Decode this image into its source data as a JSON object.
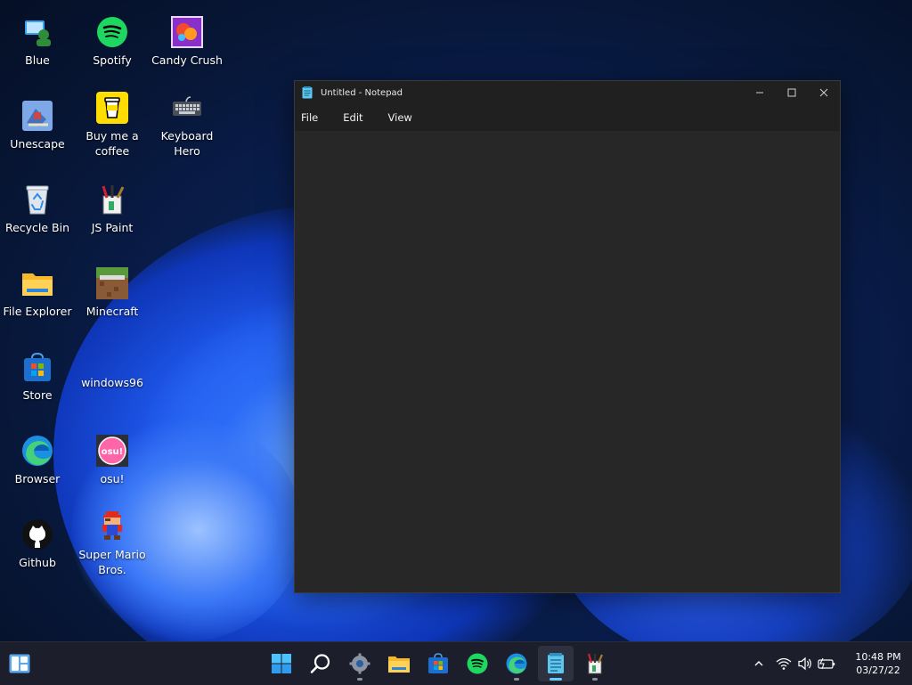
{
  "desktop": {
    "icons": [
      {
        "id": "blue",
        "label": "Blue"
      },
      {
        "id": "spotify",
        "label": "Spotify"
      },
      {
        "id": "candy-crush",
        "label": "Candy Crush"
      },
      {
        "id": "unescape",
        "label": "Unescape"
      },
      {
        "id": "buy-me-a-coffee",
        "label": "Buy me a coffee"
      },
      {
        "id": "keyboard-hero",
        "label": "Keyboard Hero"
      },
      {
        "id": "recycle-bin",
        "label": "Recycle Bin"
      },
      {
        "id": "js-paint",
        "label": "JS Paint"
      },
      {
        "id": "file-explorer",
        "label": "File Explorer"
      },
      {
        "id": "minecraft",
        "label": "Minecraft"
      },
      {
        "id": "store",
        "label": "Store"
      },
      {
        "id": "windows96",
        "label": "windows96"
      },
      {
        "id": "browser",
        "label": "Browser"
      },
      {
        "id": "osu",
        "label": "osu!"
      },
      {
        "id": "github",
        "label": "Github"
      },
      {
        "id": "super-mario-bros",
        "label": "Super Mario Bros."
      }
    ]
  },
  "notepad": {
    "title": "Untitled - Notepad",
    "menu": [
      "File",
      "Edit",
      "View"
    ],
    "content": ""
  },
  "osu_badge": "osu!",
  "taskbar": {
    "pinned": [
      "start",
      "search",
      "settings",
      "file-explorer",
      "store",
      "spotify",
      "edge",
      "notepad",
      "js-paint"
    ],
    "active": "notepad",
    "clock": {
      "time": "10:48 PM",
      "date": "03/27/22"
    }
  }
}
